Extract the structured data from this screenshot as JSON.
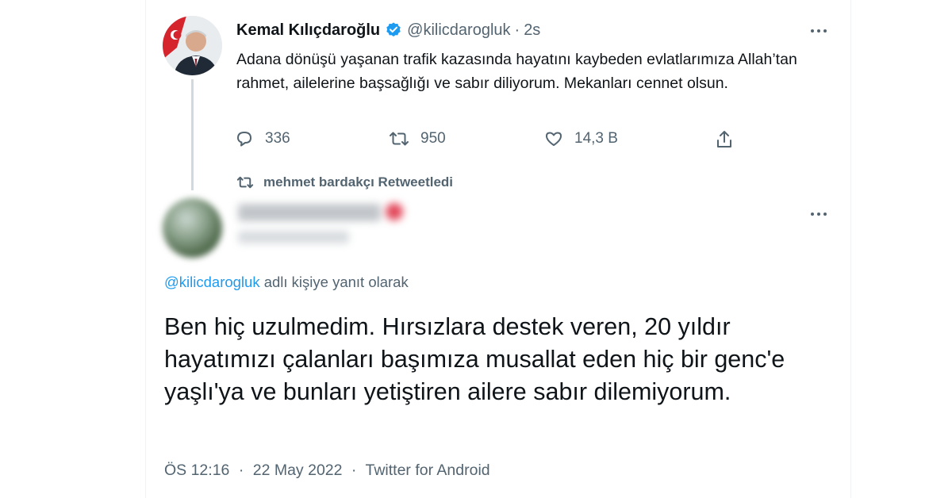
{
  "parent_tweet": {
    "author_name": "Kemal Kılıçdaroğlu",
    "author_handle": "@kilicdarogluk",
    "separator": "·",
    "time_ago": "2s",
    "text": "Adana dönüşü yaşanan trafik kazasında hayatını kaybeden evlatlarımıza Allah’tan rahmet, ailelerine başsağlığı ve sabır diliyorum. Mekanları cennet olsun.",
    "reply_count": "336",
    "retweet_count": "950",
    "like_count": "14,3 B",
    "icons": [
      "verified-badge-icon",
      "more-icon",
      "reply-icon",
      "retweet-icon",
      "like-icon",
      "share-icon"
    ],
    "accent_color": "#1d9bf0"
  },
  "retweet_label": {
    "text": "mehmet bardakçı Retweetledi"
  },
  "reply_tweet": {
    "replying_to_handle": "@kilicdarogluk",
    "replying_to_suffix": "adlı kişiye yanıt olarak",
    "text": "Ben hiç uzulmedim. Hırsızlara destek veren, 20 yıldır hayatımızı çalanları başımıza musallat eden  hiç bir genc'e yaşlı'ya ve bunları yetiştiren ailere sabır dilemiyorum.",
    "time": "ÖS 12:16",
    "separator": "·",
    "date": "22 May 2022",
    "client": "Twitter for Android"
  },
  "colors": {
    "text_primary": "#0f1419",
    "text_secondary": "#536471",
    "link": "#1d9bf0",
    "verified": "#1d9bf0"
  }
}
